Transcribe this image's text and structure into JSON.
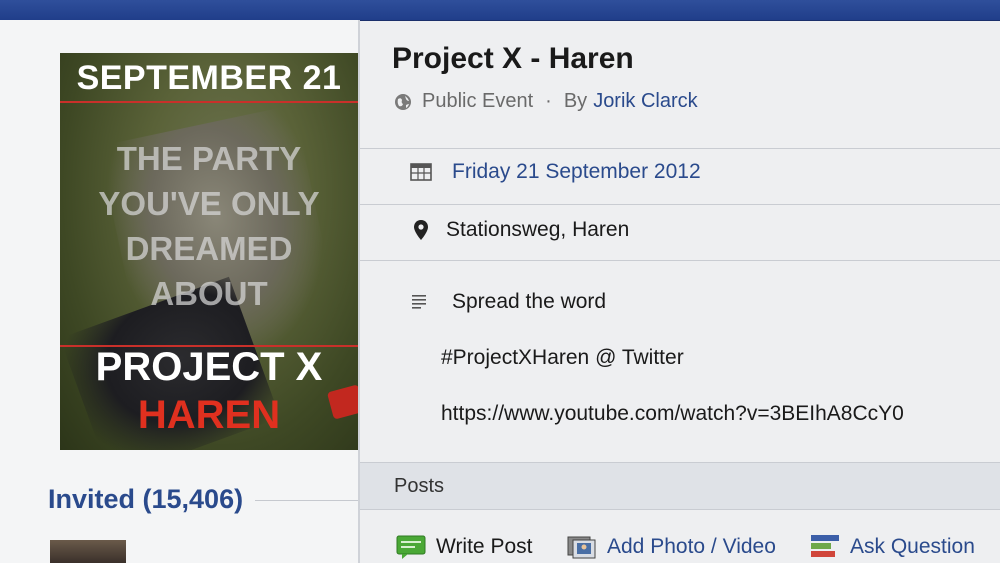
{
  "event": {
    "title": "Project X  -  Haren",
    "visibility": "Public Event",
    "separator": "·",
    "by_label": "By",
    "author": "Jorik Clarck",
    "date": "Friday 21 September 2012",
    "location": "Stationsweg, Haren",
    "description": [
      "Spread the word",
      "#ProjectXHaren @ Twitter",
      "https://www.youtube.com/watch?v=3BEIhA8CcY0"
    ]
  },
  "poster": {
    "date_text": "SEPTEMBER 21",
    "tagline": [
      "THE PARTY",
      "YOU'VE ONLY",
      "DREAMED",
      "ABOUT"
    ],
    "title_line1": "PROJECT X",
    "title_line2": "HAREN"
  },
  "invited": {
    "label": "Invited (15,406)"
  },
  "posts": {
    "header": "Posts",
    "actions": {
      "write": "Write Post",
      "photo": "Add Photo / Video",
      "ask": "Ask Question"
    }
  },
  "icons": {
    "globe": "globe-icon",
    "calendar": "calendar-icon",
    "pin": "map-pin-icon",
    "lines": "description-lines-icon",
    "write": "write-post-icon",
    "photo": "photo-video-icon",
    "ask": "ask-question-icon"
  },
  "colors": {
    "topbar": "#2f4f9b",
    "link": "#2a4a8c",
    "poster_red": "#e0301f"
  }
}
